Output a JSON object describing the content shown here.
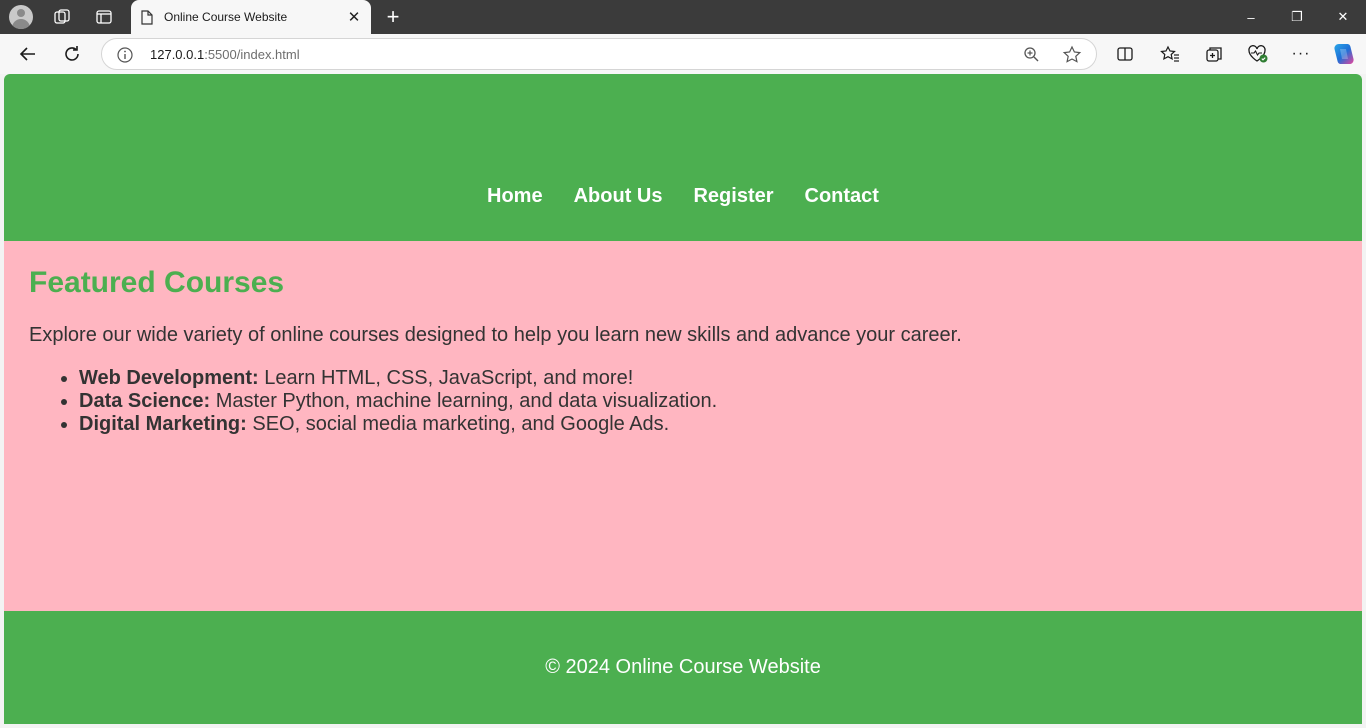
{
  "browser": {
    "tab_title": "Online Course Website",
    "tab_close": "✕",
    "new_tab": "+",
    "url_host": "127.0.0.1",
    "url_rest": ":5500/index.html",
    "more_label": "···",
    "window_controls": {
      "minimize": "–",
      "restore": "❐",
      "close": "✕"
    }
  },
  "site": {
    "nav": [
      "Home",
      "About Us",
      "Register",
      "Contact"
    ],
    "heading": "Featured Courses",
    "intro": "Explore our wide variety of online courses designed to help you learn new skills and advance your career.",
    "courses": [
      {
        "name": "Web Development:",
        "desc": " Learn HTML, CSS, JavaScript, and more!"
      },
      {
        "name": "Data Science:",
        "desc": " Master Python, machine learning, and data visualization."
      },
      {
        "name": "Digital Marketing:",
        "desc": " SEO, social media marketing, and Google Ads."
      }
    ],
    "footer": "© 2024 Online Course Website"
  },
  "colors": {
    "primary": "#4caf50",
    "content_bg": "#ffb6c1",
    "text": "#333333"
  }
}
